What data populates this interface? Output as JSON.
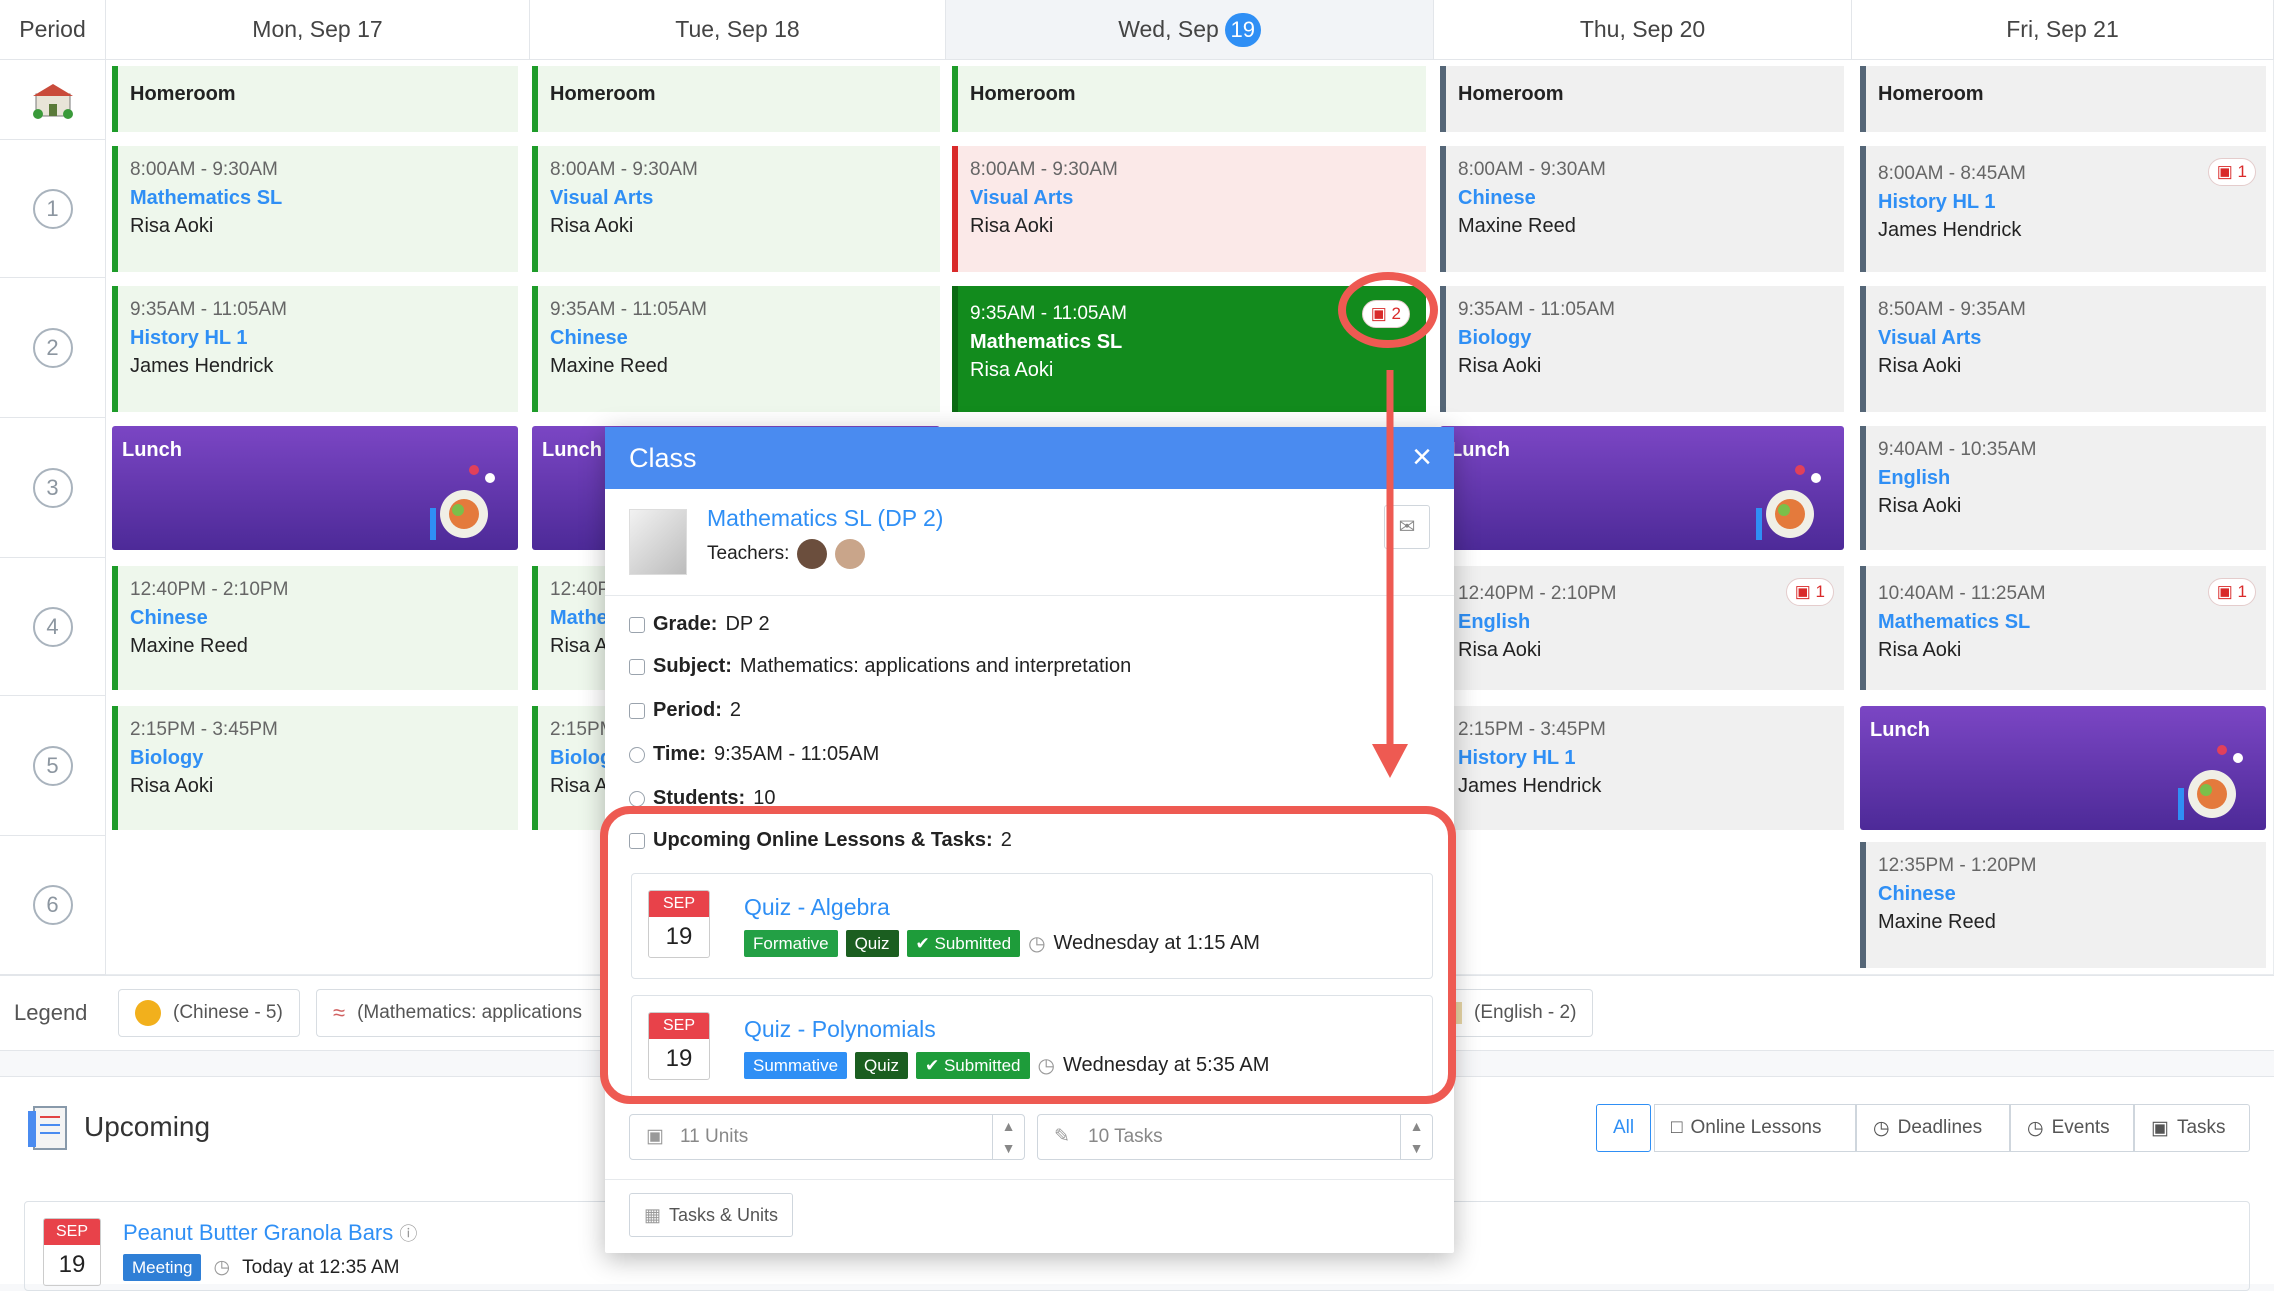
{
  "header": {
    "period": "Period",
    "days": [
      "Mon, Sep 17",
      "Tue, Sep 18",
      "Wed, Sep",
      "Thu, Sep 20",
      "Fri, Sep 21"
    ],
    "today_num": "19"
  },
  "periods": [
    "1",
    "2",
    "3",
    "4",
    "5",
    "6"
  ],
  "homeroom": "Homeroom",
  "cells": {
    "mon1": {
      "time": "8:00AM - 9:30AM",
      "subject": "Mathematics SL",
      "teacher": "Risa Aoki"
    },
    "tue1": {
      "time": "8:00AM - 9:30AM",
      "subject": "Visual Arts",
      "teacher": "Risa Aoki"
    },
    "wed1": {
      "time": "8:00AM - 9:30AM",
      "subject": "Visual Arts",
      "teacher": "Risa Aoki"
    },
    "thu1": {
      "time": "8:00AM - 9:30AM",
      "subject": "Chinese",
      "teacher": "Maxine Reed"
    },
    "fri1": {
      "time": "8:00AM - 8:45AM",
      "subject": "History HL 1",
      "teacher": "James Hendrick",
      "badge": "1"
    },
    "mon2": {
      "time": "9:35AM - 11:05AM",
      "subject": "History HL 1",
      "teacher": "James Hendrick"
    },
    "tue2": {
      "time": "9:35AM - 11:05AM",
      "subject": "Chinese",
      "teacher": "Maxine Reed"
    },
    "wed2": {
      "time": "9:35AM - 11:05AM",
      "subject": "Mathematics SL",
      "teacher": "Risa Aoki",
      "badge": "2"
    },
    "thu2": {
      "time": "9:35AM - 11:05AM",
      "subject": "Biology",
      "teacher": "Risa Aoki"
    },
    "fri2": {
      "time": "8:50AM - 9:35AM",
      "subject": "Visual Arts",
      "teacher": "Risa Aoki"
    },
    "lunch": "Lunch",
    "thu3": "Lunch",
    "fri3": {
      "time": "9:40AM - 10:35AM",
      "subject": "English",
      "teacher": "Risa Aoki"
    },
    "mon4": {
      "time": "12:40PM - 2:10PM",
      "subject": "Chinese",
      "teacher": "Maxine Reed"
    },
    "tue4": {
      "time": "12:40P",
      "subject": "Mathe",
      "teacher": "Risa Ao"
    },
    "thu4": {
      "time": "12:40PM - 2:10PM",
      "subject": "English",
      "teacher": "Risa Aoki",
      "badge": "1"
    },
    "fri4": {
      "time": "10:40AM - 11:25AM",
      "subject": "Mathematics SL",
      "teacher": "Risa Aoki",
      "badge": "1"
    },
    "mon5": {
      "time": "2:15PM - 3:45PM",
      "subject": "Biology",
      "teacher": "Risa Aoki"
    },
    "tue5": {
      "time": "2:15PM",
      "subject": "Biolog",
      "teacher": "Risa Ao"
    },
    "thu5": {
      "time": "2:15PM - 3:45PM",
      "subject": "History HL 1",
      "teacher": "James Hendrick"
    },
    "fri5": "Lunch",
    "fri6": {
      "time": "12:35PM - 1:20PM",
      "subject": "Chinese",
      "teacher": "Maxine Reed"
    }
  },
  "legend": {
    "label": "Legend",
    "items": [
      "(Chinese - 5)",
      "(Mathematics: applications",
      "(English - 2)"
    ]
  },
  "upcoming": {
    "title": "Upcoming",
    "filters": [
      "All",
      "Online Lessons",
      "Deadlines",
      "Events",
      "Tasks"
    ],
    "item": {
      "month": "SEP",
      "day": "19",
      "title": "Peanut Butter Granola Bars",
      "tag": "Meeting",
      "time": "Today at 12:35 AM"
    }
  },
  "modal": {
    "title": "Class",
    "class_name": "Mathematics SL (DP 2)",
    "teachers_label": "Teachers:",
    "grade_label": "Grade:",
    "grade": "DP 2",
    "subject_label": "Subject:",
    "subject": "Mathematics: applications and interpretation",
    "period_label": "Period:",
    "period": "2",
    "time_label": "Time:",
    "time": "9:35AM - 11:05AM",
    "students_label": "Students:",
    "students": "10",
    "upcoming_label": "Upcoming Online Lessons & Tasks:",
    "upcoming_count": "2",
    "tasks": [
      {
        "month": "SEP",
        "day": "19",
        "title": "Quiz - Algebra",
        "type": "Formative",
        "kind": "Quiz",
        "status": "Submitted",
        "when": "Wednesday at 1:15 AM"
      },
      {
        "month": "SEP",
        "day": "19",
        "title": "Quiz - Polynomials",
        "type": "Summative",
        "kind": "Quiz",
        "status": "Submitted",
        "when": "Wednesday at 5:35 AM"
      }
    ],
    "units_placeholder": "11 Units",
    "tasks_placeholder": "10 Tasks",
    "footer_button": "Tasks & Units"
  },
  "colors": {
    "accent": "#2f8ff5",
    "annotation": "#ee5a52",
    "green": "#1e9c2a",
    "lunch": "#5b33a8"
  }
}
